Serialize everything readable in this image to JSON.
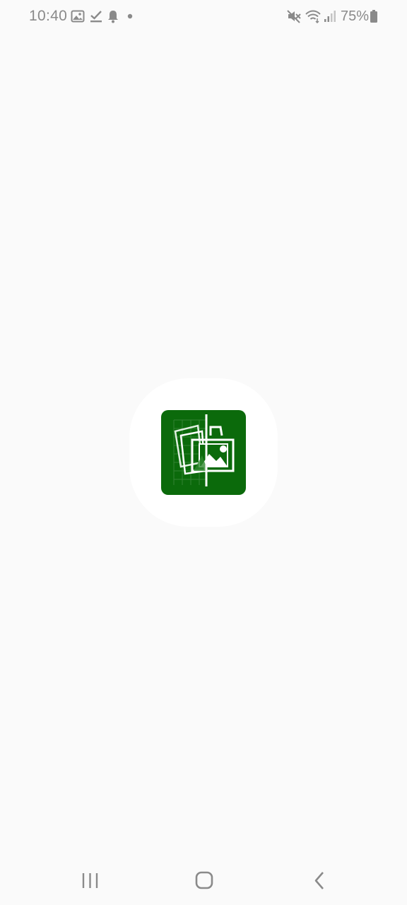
{
  "status_bar": {
    "time": "10:40",
    "battery_percent": "75%",
    "icons": [
      "gallery-icon",
      "check-download-icon",
      "bell-icon",
      "dot-icon",
      "mute-icon",
      "wifi-icon",
      "signal-icon",
      "battery-icon"
    ]
  },
  "splash": {
    "icon_name": "image-compare-app-icon",
    "icon_color": "#0b6a0b"
  },
  "nav_bar": {
    "buttons": [
      "recent-apps-button",
      "home-button",
      "back-button"
    ]
  }
}
